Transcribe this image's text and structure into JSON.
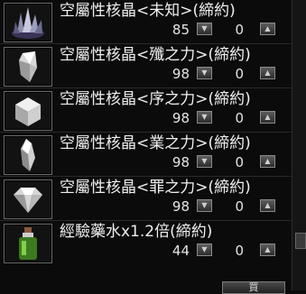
{
  "items": [
    {
      "name": "空屬性核晶<未知>(締約)",
      "stock": "85",
      "qty": "0",
      "icon": "cluster-crystal-icon"
    },
    {
      "name": "空屬性核晶<殲之力>(締約)",
      "stock": "98",
      "qty": "0",
      "icon": "shard-crystal-icon"
    },
    {
      "name": "空屬性核晶<序之力>(締約)",
      "stock": "98",
      "qty": "0",
      "icon": "cube-crystal-icon"
    },
    {
      "name": "空屬性核晶<業之力>(締約)",
      "stock": "98",
      "qty": "0",
      "icon": "long-crystal-icon"
    },
    {
      "name": "空屬性核晶<罪之力>(締約)",
      "stock": "98",
      "qty": "0",
      "icon": "diamond-crystal-icon"
    },
    {
      "name": "經驗藥水x1.2倍(締約)",
      "stock": "44",
      "qty": "0",
      "icon": "green-potion-icon"
    }
  ],
  "controls": {
    "down_arrow": "▼",
    "up_arrow": "▲",
    "buy_label": "買"
  }
}
